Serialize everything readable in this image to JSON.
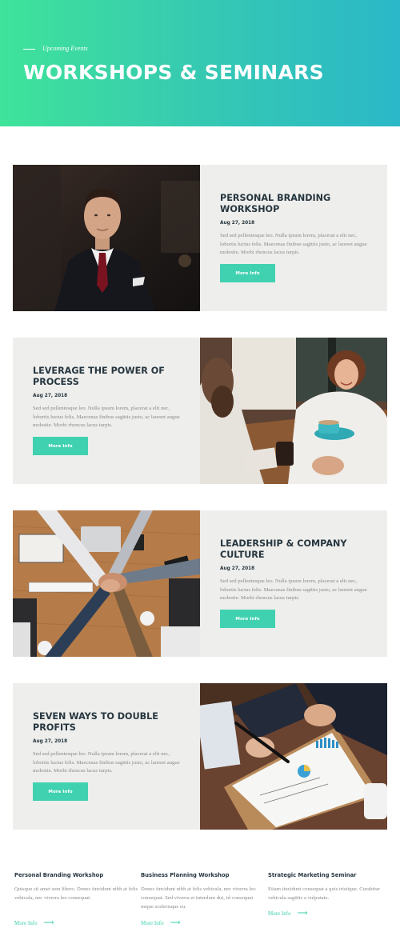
{
  "hero": {
    "subtitle": "Upcoming Events",
    "title": "WORKSHOPS & SEMINARS"
  },
  "events": [
    {
      "title": "PERSONAL BRANDING WORKSHOP",
      "date": "Aug 27, 2018",
      "description": "Sed sed pellentesque leo. Nulla ipsum lorem, placerat a elit nec, lobortis luctus felis. Maecenas finibus sagittis justo, ac laoreet augue molestie. Morbi rhoncus lacus turpis.",
      "button": "More Info",
      "photo": "businessman-portrait"
    },
    {
      "title": "LEVERAGE THE POWER OF PROCESS",
      "date": "Aug 27, 2018",
      "description": "Sed sed pellentesque leo. Nulla ipsum lorem, placerat a elit nec, lobortis luctus felis. Maecenas finibus sagittis justo, ac laoreet augue molestie. Morbi rhoncus lacus turpis.",
      "button": "More Info",
      "photo": "cafe-meeting"
    },
    {
      "title": "LEADERSHIP & COMPANY CULTURE",
      "date": "Aug 27, 2018",
      "description": "Sed sed pellentesque leo. Nulla ipsum lorem, placerat a elit nec, lobortis luctus felis. Maecenas finibus sagittis justo, ac laoreet augue molestie. Morbi rhoncus lacus turpis.",
      "button": "More Info",
      "photo": "team-hands-stack"
    },
    {
      "title": "SEVEN WAYS TO DOUBLE PROFITS",
      "date": "Aug 27, 2018",
      "description": "Sed sed pellentesque leo. Nulla ipsum lorem, placerat a elit nec, lobortis luctus felis. Maecenas finibus sagittis justo, ac laoreet augue molestie. Morbi rhoncus lacus turpis.",
      "button": "More Info",
      "photo": "signing-document"
    }
  ],
  "footer_columns": [
    {
      "title": "Personal Branding Workshop",
      "description": "Quisque sit amet sem libero. Donec tincidunt nibh at felis vehicula, nec viverra leo consequat.",
      "link": "More Info"
    },
    {
      "title": "Business Planning Workshop",
      "description": "Donec tincidunt nibh at felis vehicula, nec viverra leo consequat. Sed viverra et interdum dui, id consequat neque scelerisque eu.",
      "link": "More Info"
    },
    {
      "title": "Strategic Marketing Seminar",
      "description": "Etiam tincidunt consequat a quis tristique. Curabitur vehicula sagittis a vulputate.",
      "link": "More Info"
    }
  ],
  "icons": {
    "arrow": "arrow-right-icon"
  },
  "colors": {
    "accent": "#40d1b0",
    "gradient_start": "#3fe39a",
    "gradient_end": "#2bb8c8",
    "heading": "#26363f",
    "card_bg": "#eeeeec"
  }
}
